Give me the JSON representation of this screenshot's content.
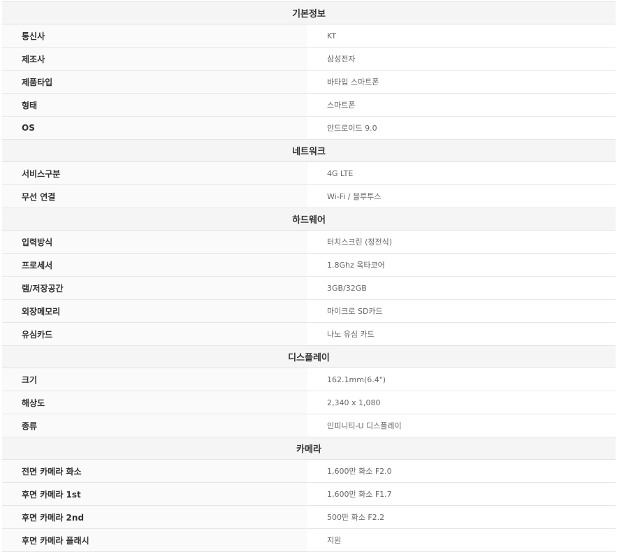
{
  "sections": [
    {
      "title": "기본정보",
      "rows": [
        {
          "label": "통신사",
          "value": "KT"
        },
        {
          "label": "제조사",
          "value": "삼성전자"
        },
        {
          "label": "제품타입",
          "value": "바타입 스마트폰"
        },
        {
          "label": "형태",
          "value": "스마트폰"
        },
        {
          "label": "OS",
          "value": "안드로이드 9.0"
        }
      ]
    },
    {
      "title": "네트워크",
      "rows": [
        {
          "label": "서비스구분",
          "value": "4G LTE"
        },
        {
          "label": "무선 연결",
          "value": "Wi-Fi / 블루투스"
        }
      ]
    },
    {
      "title": "하드웨어",
      "rows": [
        {
          "label": "입력방식",
          "value": "터치스크린 (정전식)"
        },
        {
          "label": "프로세서",
          "value": "1.8Ghz 옥타코어"
        },
        {
          "label": "램/저장공간",
          "value": "3GB/32GB"
        },
        {
          "label": "외장메모리",
          "value": "마이크로 SD카드"
        },
        {
          "label": "유심카드",
          "value": "나노 유심 카드"
        }
      ]
    },
    {
      "title": "디스플레이",
      "rows": [
        {
          "label": "크기",
          "value": "162.1mm(6.4\")"
        },
        {
          "label": "해상도",
          "value": "2,340 x 1,080"
        },
        {
          "label": "종류",
          "value": "인피니티-U 디스플레이"
        }
      ]
    },
    {
      "title": "카메라",
      "rows": [
        {
          "label": "전면 카메라 화소",
          "value": "1,600만 화소 F2.0"
        },
        {
          "label": "후면 카메라 1st",
          "value": "1,600만 화소 F1.7"
        },
        {
          "label": "후면 카메라 2nd",
          "value": "500만 화소 F2.2"
        },
        {
          "label": "후면 카메라 플래시",
          "value": "지원"
        }
      ]
    }
  ]
}
